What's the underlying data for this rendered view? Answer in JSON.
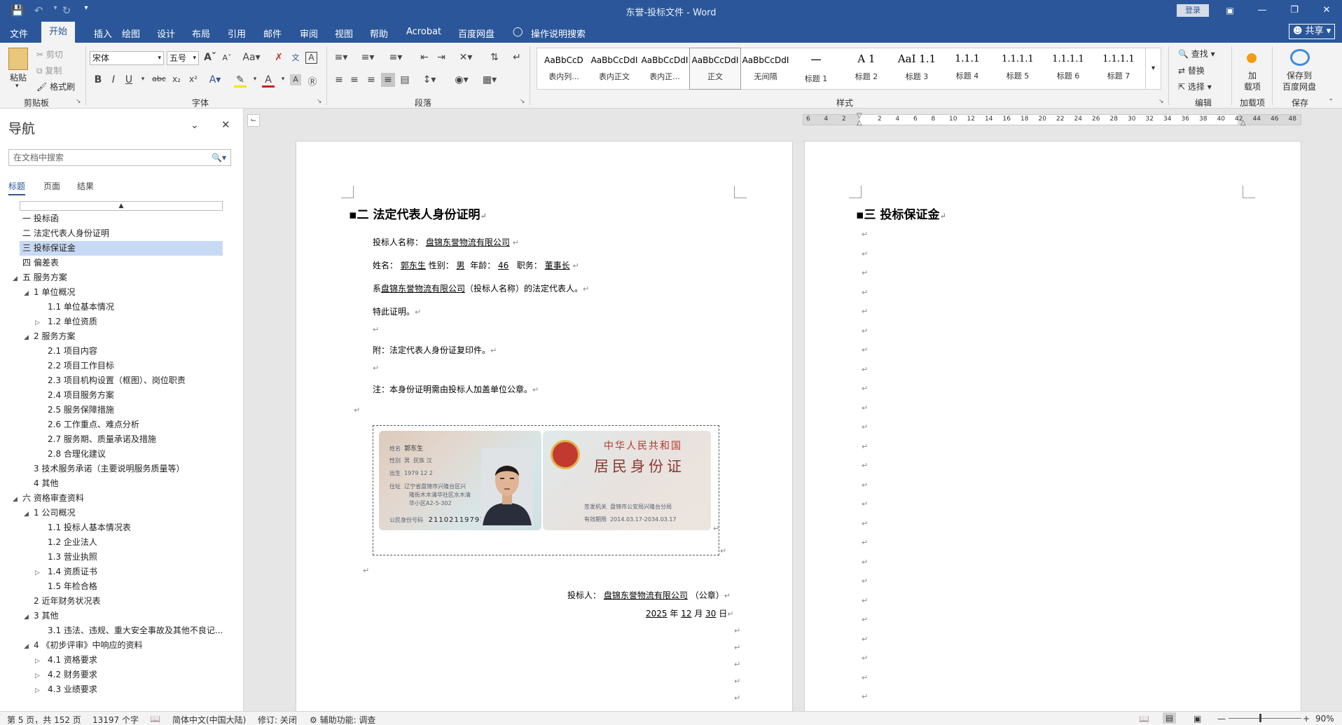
{
  "titlebar": {
    "title": "东誉-投标文件  -  Word",
    "login": "登录"
  },
  "menu": {
    "tabs": [
      "文件",
      "开始",
      "插入",
      "绘图",
      "设计",
      "布局",
      "引用",
      "邮件",
      "审阅",
      "视图",
      "帮助",
      "Acrobat",
      "百度网盘",
      "操作说明搜索"
    ],
    "share": "共享"
  },
  "ribbon": {
    "clipboard": {
      "paste": "粘贴",
      "cut": "剪切",
      "copy": "复制",
      "format_painter": "格式刷",
      "label": "剪贴板"
    },
    "font": {
      "name": "宋体",
      "size": "五号",
      "label": "字体"
    },
    "paragraph": {
      "label": "段落"
    },
    "styles": {
      "label": "样式",
      "items": [
        {
          "preview": "AaBbCcD",
          "name": "表内列..."
        },
        {
          "preview": "AaBbCcDdI",
          "name": "表内正文"
        },
        {
          "preview": "AaBbCcDdI",
          "name": "表内正..."
        },
        {
          "preview": "AaBbCcDdI",
          "name": "正文"
        },
        {
          "preview": "AaBbCcDdI",
          "name": "无间隔"
        },
        {
          "preview": "一",
          "name": "标题 1"
        },
        {
          "preview": "A 1",
          "name": "标题 2"
        },
        {
          "preview": "AaI 1.1",
          "name": "标题 3"
        },
        {
          "preview": "1.1.1",
          "name": "标题 4"
        },
        {
          "preview": "1.1.1.1",
          "name": "标题 5"
        },
        {
          "preview": "1.1.1.1",
          "name": "标题 6"
        },
        {
          "preview": "1.1.1.1",
          "name": "标题 7"
        }
      ]
    },
    "editing": {
      "find": "查找",
      "replace": "替换",
      "select": "选择",
      "label": "编辑"
    },
    "addins": {
      "load": "加\n载项",
      "label": "加载项"
    },
    "save": {
      "save_to": "保存到\n百度网盘",
      "label": "保存"
    }
  },
  "nav": {
    "title": "导航",
    "search_placeholder": "在文档中搜索",
    "tabs": [
      "标题",
      "页面",
      "结果"
    ],
    "items": [
      {
        "text": "一 投标函",
        "level": 0,
        "toggle": ""
      },
      {
        "text": "二 法定代表人身份证明",
        "level": 0,
        "toggle": ""
      },
      {
        "text": "三 投标保证金",
        "level": 0,
        "toggle": "",
        "selected": true
      },
      {
        "text": "四 偏差表",
        "level": 0,
        "toggle": ""
      },
      {
        "text": "五 服务方案",
        "level": 0,
        "toggle": "◢"
      },
      {
        "text": "1 单位概况",
        "level": 1,
        "toggle": "◢"
      },
      {
        "text": "1.1 单位基本情况",
        "level": 2,
        "toggle": ""
      },
      {
        "text": "1.2 单位资质",
        "level": 2,
        "toggle": "▷"
      },
      {
        "text": "2 服务方案",
        "level": 1,
        "toggle": "◢"
      },
      {
        "text": "2.1 项目内容",
        "level": 2,
        "toggle": ""
      },
      {
        "text": "2.2 项目工作目标",
        "level": 2,
        "toggle": ""
      },
      {
        "text": "2.3 项目机构设置（框图）、岗位职责",
        "level": 2,
        "toggle": ""
      },
      {
        "text": "2.4 项目服务方案",
        "level": 2,
        "toggle": ""
      },
      {
        "text": "2.5 服务保障措施",
        "level": 2,
        "toggle": ""
      },
      {
        "text": "2.6 工作重点、难点分析",
        "level": 2,
        "toggle": ""
      },
      {
        "text": "2.7 服务期、质量承诺及措施",
        "level": 2,
        "toggle": ""
      },
      {
        "text": "2.8 合理化建议",
        "level": 2,
        "toggle": ""
      },
      {
        "text": "3 技术服务承诺（主要说明服务质量等）",
        "level": 1,
        "toggle": ""
      },
      {
        "text": "4 其他",
        "level": 1,
        "toggle": ""
      },
      {
        "text": "六 资格审查资料",
        "level": 0,
        "toggle": "◢"
      },
      {
        "text": "1 公司概况",
        "level": 1,
        "toggle": "◢"
      },
      {
        "text": "1.1 投标人基本情况表",
        "level": 2,
        "toggle": ""
      },
      {
        "text": "1.2 企业法人",
        "level": 2,
        "toggle": ""
      },
      {
        "text": "1.3 营业执照",
        "level": 2,
        "toggle": ""
      },
      {
        "text": "1.4 资质证书",
        "level": 2,
        "toggle": "▷"
      },
      {
        "text": "1.5 年检合格",
        "level": 2,
        "toggle": ""
      },
      {
        "text": "2 近年财务状况表",
        "level": 1,
        "toggle": ""
      },
      {
        "text": "3 其他",
        "level": 1,
        "toggle": "◢"
      },
      {
        "text": "3.1 违法、违规、重大安全事故及其他不良记...",
        "level": 2,
        "toggle": ""
      },
      {
        "text": "4 《初步评审》中响应的资料",
        "level": 1,
        "toggle": "◢"
      },
      {
        "text": "4.1 资格要求",
        "level": 2,
        "toggle": "▷"
      },
      {
        "text": "4.2 财务要求",
        "level": 2,
        "toggle": "▷"
      },
      {
        "text": "4.3 业绩要求",
        "level": 2,
        "toggle": "▷"
      }
    ]
  },
  "ruler": {
    "labels": [
      "6",
      "4",
      "2",
      "",
      "2",
      "4",
      "6",
      "8",
      "10",
      "12",
      "14",
      "16",
      "18",
      "20",
      "22",
      "24",
      "26",
      "28",
      "30",
      "32",
      "34",
      "36",
      "38",
      "40",
      "42",
      "44",
      "46",
      "48"
    ]
  },
  "doc": {
    "left": {
      "heading": "二 法定代表人身份证明",
      "bidder_label": "投标人名称：",
      "bidder_name": "盘锦东誉物流有限公司",
      "name_label": "姓名：",
      "name": "郭东生",
      "gender_label": "性别：",
      "gender": "男",
      "age_label": "年龄：",
      "age": "46",
      "title_label": "职务：",
      "title": "董事长",
      "line3_prefix": "系",
      "line3_company": "盘锦东誉物流有限公司",
      "line3_suffix": "（投标人名称）的法定代表人。",
      "certify": "特此证明。",
      "attachment": "附：法定代表人身份证复印件。",
      "note": "注：本身份证明需由投标人加盖单位公章。",
      "sign_label": "投标人：",
      "sign_company": "盘锦东誉物流有限公司",
      "sign_suffix": "（公章）",
      "date_year": "2025",
      "date_month": "12",
      "date_day": "30",
      "year_char": "年",
      "month_char": "月",
      "day_char": "日",
      "id_card": {
        "name_label": "姓名",
        "name": "郭东生",
        "gender_label": "性别",
        "gender": "男",
        "ethnicity_label": "民族",
        "ethnicity": "汉",
        "birth_label": "出生",
        "birth": "1979  12  2",
        "address_label": "住址",
        "address_1": "辽宁省盘锦市兴隆台区兴",
        "address_2": "隆街木木清华社区水木清",
        "address_3": "华小区A2-5-302",
        "id_label": "公民身份号码",
        "id_number": "211021197912020031",
        "country": "中华人民共和国",
        "card_title": "居民身份证",
        "authority_label": "签发机关",
        "authority": "盘锦市公安局兴隆台分局",
        "validity_label": "有效期限",
        "validity": "2014.03.17-2034.03.17"
      }
    },
    "right": {
      "heading": "三 投标保证金"
    }
  },
  "status": {
    "page": "第 5 页，共 152 页",
    "words": "13197 个字",
    "language": "简体中文(中国大陆)",
    "track": "修订: 关闭",
    "accessibility": "辅助功能: 调查",
    "zoom": "90%"
  },
  "colors": {
    "brand": "#2b579a",
    "nav_selected": "#c8d9f3"
  }
}
